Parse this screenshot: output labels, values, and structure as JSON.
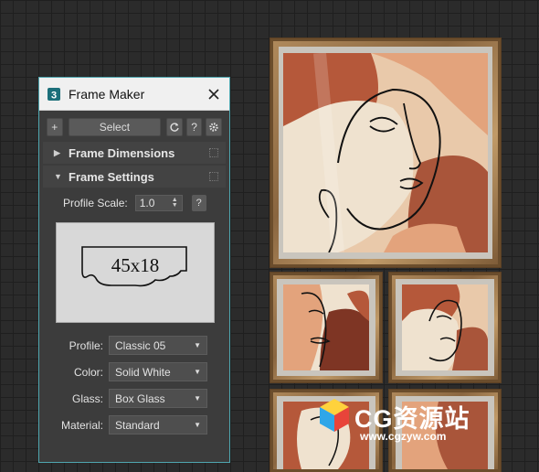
{
  "window": {
    "title": "Frame Maker",
    "app_icon": "3dsmax-logo-icon",
    "close_icon": "close-icon"
  },
  "toolbar": {
    "add_label": "+",
    "select_label": "Select",
    "refresh_icon": "refresh-icon",
    "help_label": "?",
    "settings_icon": "gear-icon"
  },
  "sections": {
    "dimensions": {
      "label": "Frame Dimensions",
      "expanded": false
    },
    "settings": {
      "label": "Frame Settings",
      "expanded": true
    }
  },
  "profile_scale": {
    "label": "Profile Scale:",
    "value": "1.0",
    "help_label": "?"
  },
  "preview": {
    "label": "45x18"
  },
  "fields": [
    {
      "label": "Profile:",
      "value": "Classic 05"
    },
    {
      "label": "Color:",
      "value": "Solid White"
    },
    {
      "label": "Glass:",
      "value": "Box Glass"
    },
    {
      "label": "Material:",
      "value": "Standard"
    }
  ],
  "watermark": {
    "title": "CG资源站",
    "url": "www.cgzyw.com"
  },
  "colors": {
    "panel_border": "#4fa7b0",
    "panel_bg": "#3c3c3c",
    "frame_wood": "#a07a4c",
    "art_terracotta": "#b5583a",
    "art_peach": "#e2a47e",
    "art_cream": "#efe2cf"
  }
}
